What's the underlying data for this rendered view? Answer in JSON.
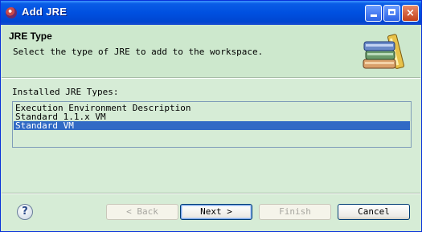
{
  "window": {
    "title": "Add JRE",
    "controls": {
      "minimize": "minimize-icon",
      "maximize": "maximize-icon",
      "close": "×"
    }
  },
  "header": {
    "title": "JRE Type",
    "description": "Select the type of JRE to add to the workspace.",
    "icon": "books-icon"
  },
  "list": {
    "label": "Installed JRE Types:",
    "items": [
      {
        "label": "Execution Environment Description",
        "selected": false
      },
      {
        "label": "Standard 1.1.x VM",
        "selected": false
      },
      {
        "label": "Standard VM",
        "selected": true
      }
    ]
  },
  "footer": {
    "help": "?",
    "buttons": {
      "back": {
        "label": "< Back",
        "enabled": false
      },
      "next": {
        "label": "Next >",
        "enabled": true,
        "default": true
      },
      "finish": {
        "label": "Finish",
        "enabled": false
      },
      "cancel": {
        "label": "Cancel",
        "enabled": true
      }
    }
  },
  "colors": {
    "selection": "#316ac5",
    "background": "#d6ecd6",
    "titlebar": "#0050e0"
  }
}
